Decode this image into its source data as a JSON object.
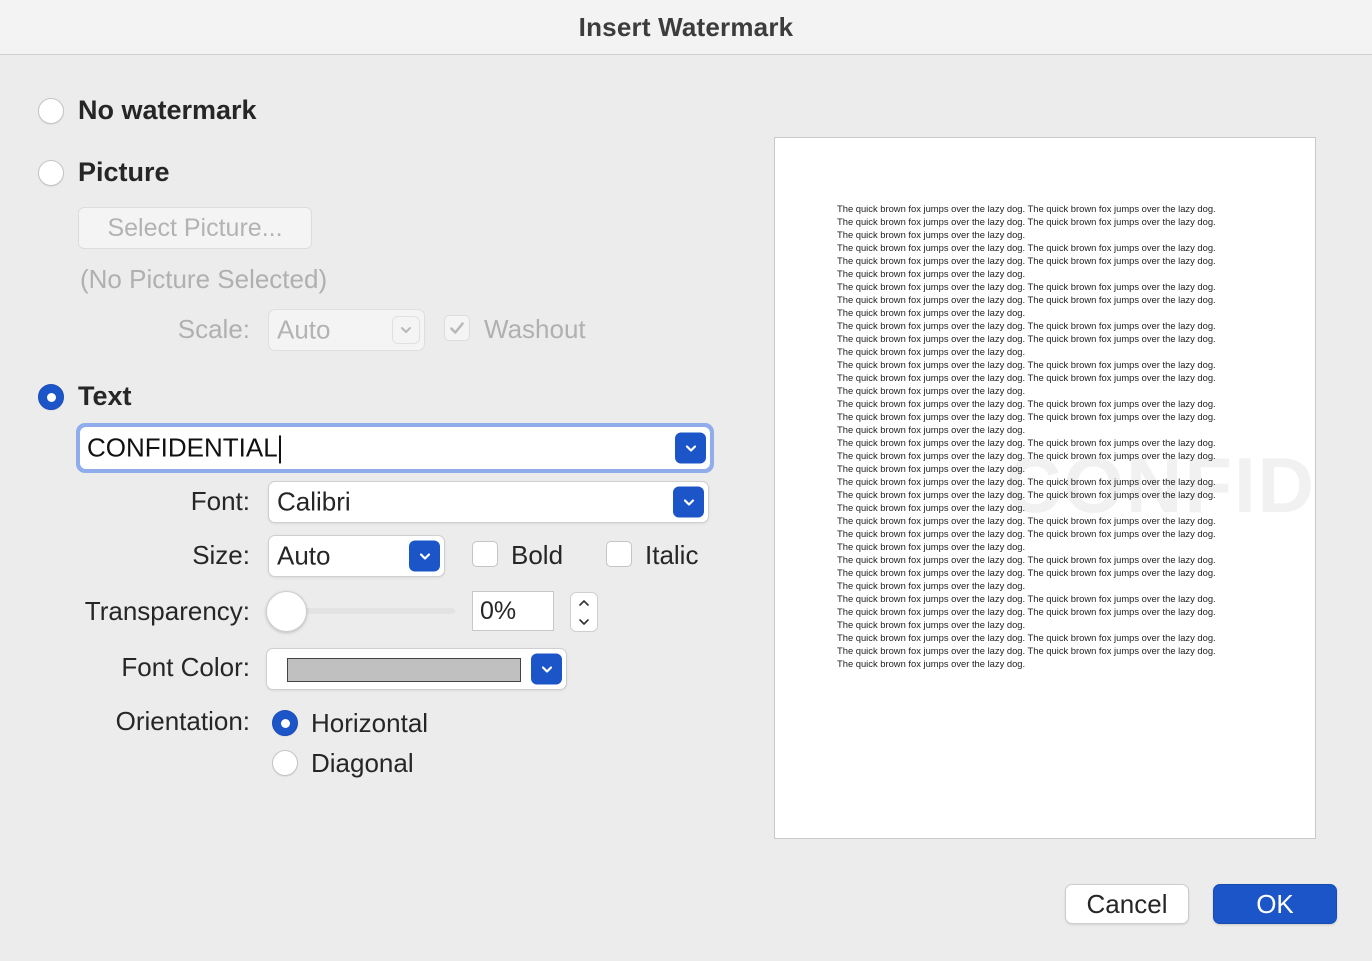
{
  "window": {
    "title": "Insert Watermark"
  },
  "options": {
    "no_watermark": {
      "label": "No watermark",
      "selected": false
    },
    "picture": {
      "label": "Picture",
      "selected": false
    },
    "text": {
      "label": "Text",
      "selected": true
    }
  },
  "picture": {
    "select_button": "Select Picture...",
    "status": "(No Picture Selected)",
    "scale_label": "Scale:",
    "scale_value": "Auto",
    "washout_label": "Washout",
    "washout_checked": true
  },
  "text": {
    "value": "CONFIDENTIAL",
    "font_label": "Font:",
    "font_value": "Calibri",
    "size_label": "Size:",
    "size_value": "Auto",
    "bold_label": "Bold",
    "bold_checked": false,
    "italic_label": "Italic",
    "italic_checked": false,
    "transparency_label": "Transparency:",
    "transparency_value": "0%",
    "font_color_label": "Font Color:",
    "font_color": "#c0c0c0",
    "orientation_label": "Orientation:",
    "orientation_options": [
      "Horizontal",
      "Diagonal"
    ],
    "orientation_selected": "Horizontal"
  },
  "preview": {
    "watermark_text": "CONFIDENTIAL",
    "lines": [
      "The quick brown fox jumps over the lazy dog. The quick brown fox jumps over the lazy dog.",
      "The quick brown fox jumps over the lazy dog. The quick brown fox jumps over the lazy dog.",
      "The quick brown fox jumps over the lazy dog.",
      "The quick brown fox jumps over the lazy dog. The quick brown fox jumps over the lazy dog.",
      "The quick brown fox jumps over the lazy dog. The quick brown fox jumps over the lazy dog.",
      "The quick brown fox jumps over the lazy dog.",
      "The quick brown fox jumps over the lazy dog. The quick brown fox jumps over the lazy dog.",
      "The quick brown fox jumps over the lazy dog. The quick brown fox jumps over the lazy dog.",
      "The quick brown fox jumps over the lazy dog.",
      "The quick brown fox jumps over the lazy dog. The quick brown fox jumps over the lazy dog.",
      "The quick brown fox jumps over the lazy dog. The quick brown fox jumps over the lazy dog.",
      "The quick brown fox jumps over the lazy dog.",
      "The quick brown fox jumps over the lazy dog. The quick brown fox jumps over the lazy dog.",
      "The quick brown fox jumps over the lazy dog. The quick brown fox jumps over the lazy dog.",
      "The quick brown fox jumps over the lazy dog.",
      "The quick brown fox jumps over the lazy dog. The quick brown fox jumps over the lazy dog.",
      "The quick brown fox jumps over the lazy dog. The quick brown fox jumps over the lazy dog.",
      "The quick brown fox jumps over the lazy dog.",
      "The quick brown fox jumps over the lazy dog. The quick brown fox jumps over the lazy dog.",
      "The quick brown fox jumps over the lazy dog. The quick brown fox jumps over the lazy dog.",
      "The quick brown fox jumps over the lazy dog.",
      "The quick brown fox jumps over the lazy dog. The quick brown fox jumps over the lazy dog.",
      "The quick brown fox jumps over the lazy dog. The quick brown fox jumps over the lazy dog.",
      "The quick brown fox jumps over the lazy dog.",
      "The quick brown fox jumps over the lazy dog. The quick brown fox jumps over the lazy dog.",
      "The quick brown fox jumps over the lazy dog. The quick brown fox jumps over the lazy dog.",
      "The quick brown fox jumps over the lazy dog.",
      "The quick brown fox jumps over the lazy dog. The quick brown fox jumps over the lazy dog.",
      "The quick brown fox jumps over the lazy dog. The quick brown fox jumps over the lazy dog.",
      "The quick brown fox jumps over the lazy dog.",
      "The quick brown fox jumps over the lazy dog. The quick brown fox jumps over the lazy dog.",
      "The quick brown fox jumps over the lazy dog. The quick brown fox jumps over the lazy dog.",
      "The quick brown fox jumps over the lazy dog.",
      "The quick brown fox jumps over the lazy dog. The quick brown fox jumps over the lazy dog.",
      "The quick brown fox jumps over the lazy dog. The quick brown fox jumps over the lazy dog.",
      "The quick brown fox jumps over the lazy dog."
    ]
  },
  "buttons": {
    "cancel": "Cancel",
    "ok": "OK"
  },
  "colors": {
    "accent": "#1c55c8",
    "focus_ring": "#8eadea",
    "disabled_text": "#b0b0b0"
  }
}
